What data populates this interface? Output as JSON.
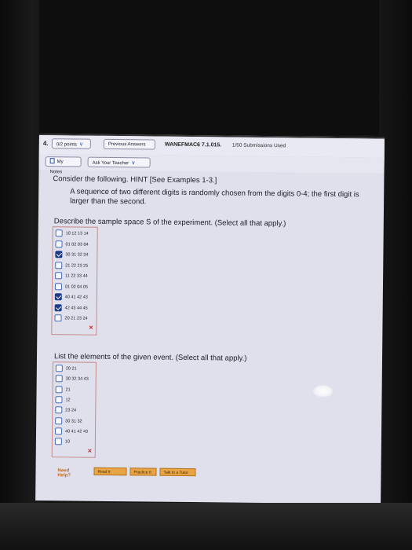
{
  "header": {
    "question_number": "4.",
    "points_label": "0/2 points",
    "previous_answers_label": "Previous Answers",
    "assignment_title": "WANEFMAC6 7.1.015.",
    "submissions_used": "1/50 Submissions Used"
  },
  "notes_bar": {
    "my_notes_label": "My Notes",
    "ask_teacher_label": "Ask Your Teacher"
  },
  "question": {
    "intro": "Consider the following. HINT [See Examples 1-3.]",
    "body": "A sequence of two different digits is randomly chosen from the digits 0-4; the first digit is larger than the second.",
    "describe_prompt": "Describe the sample space S of the experiment. (Select all that apply.)",
    "result_mark": "×"
  },
  "sample_space_options": [
    {
      "label": "10 12 13 14",
      "checked": false
    },
    {
      "label": "01 02 03 04",
      "checked": false
    },
    {
      "label": "30 31 32 34",
      "checked": true
    },
    {
      "label": "21 22 23 25",
      "checked": false
    },
    {
      "label": "11 22 33 44",
      "checked": false
    },
    {
      "label": "01 02 04 05",
      "checked": false
    },
    {
      "label": "40 41 42 43",
      "checked": true
    },
    {
      "label": "42 43 44 45",
      "checked": true
    },
    {
      "label": "20 21 23 24",
      "checked": false
    }
  ],
  "event": {
    "prompt": "List the elements of the given event. (Select all that apply.)",
    "result_mark": "×"
  },
  "event_options": [
    {
      "label": "20 21",
      "checked": false
    },
    {
      "label": "30 32 34 43",
      "checked": false
    },
    {
      "label": "21",
      "checked": false
    },
    {
      "label": "12",
      "checked": false
    },
    {
      "label": "23 24",
      "checked": false
    },
    {
      "label": "30 31 32",
      "checked": false
    },
    {
      "label": "40 41 42 43",
      "checked": false
    },
    {
      "label": "10",
      "checked": false
    }
  ],
  "help": {
    "need_help_label": "Need Help?",
    "read_it_label": "Read It",
    "practice_it_label": "Practice It",
    "talk_to_tutor_label": "Talk to a Tutor"
  }
}
